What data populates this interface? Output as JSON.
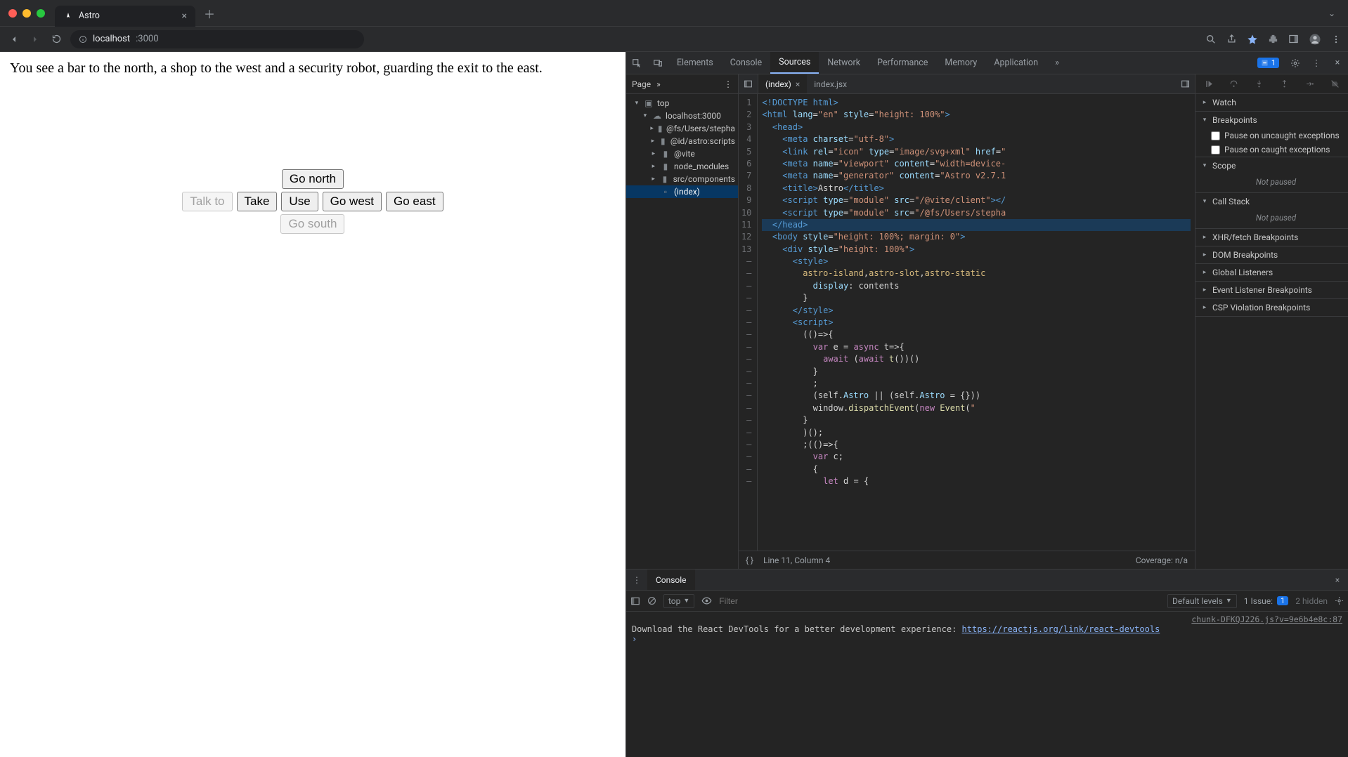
{
  "window": {
    "tab_title": "Astro",
    "url_host": "localhost",
    "url_path": ":3000"
  },
  "game": {
    "description": "You see a bar to the north, a shop to the west and a security robot, guarding the exit to the east.",
    "buttons": {
      "north": "Go north",
      "west": "Go west",
      "east": "Go east",
      "south": "Go south",
      "talk": "Talk to",
      "take": "Take",
      "use": "Use"
    }
  },
  "devtools": {
    "tabs": [
      "Elements",
      "Console",
      "Sources",
      "Network",
      "Performance",
      "Memory",
      "Application"
    ],
    "active_tab": "Sources",
    "issue_count": "1",
    "sources": {
      "left_tab": "Page",
      "tree": {
        "top": "top",
        "host": "localhost:3000",
        "items": [
          "@fs/Users/stepha",
          "@id/astro:scripts",
          "@vite",
          "node_modules",
          "src/components"
        ],
        "file": "(index)"
      },
      "editor_tabs": [
        "(index)",
        "index.jsx"
      ],
      "active_editor_tab": "(index)",
      "gutter": [
        "1",
        "2",
        "3",
        "4",
        "5",
        "6",
        "7",
        "8",
        "9",
        "10",
        "11",
        "12",
        "13",
        "–",
        "–",
        "–",
        "–",
        "–",
        "–",
        "–",
        "–",
        "–",
        "–",
        "–",
        "–",
        "–",
        "–",
        "–",
        "–",
        "–",
        "–",
        "–"
      ],
      "status_line": "Line 11, Column 4",
      "coverage": "Coverage: n/a"
    },
    "debug": {
      "sections": {
        "watch": "Watch",
        "breakpoints": "Breakpoints",
        "bp_uncaught": "Pause on uncaught exceptions",
        "bp_caught": "Pause on caught exceptions",
        "scope": "Scope",
        "scope_state": "Not paused",
        "callstack": "Call Stack",
        "callstack_state": "Not paused",
        "xhr": "XHR/fetch Breakpoints",
        "dom": "DOM Breakpoints",
        "global": "Global Listeners",
        "event": "Event Listener Breakpoints",
        "csp": "CSP Violation Breakpoints"
      }
    },
    "console": {
      "tab": "Console",
      "context": "top",
      "filter_placeholder": "Filter",
      "levels": "Default levels",
      "issues_label": "1 Issue:",
      "issues_count": "1",
      "hidden": "2 hidden",
      "log_source": "chunk-DFKQJ226.js?v=9e6b4e8c:87",
      "log_msg_a": "Download the React DevTools for a better development experience: ",
      "log_msg_link": "https://reactjs.org/link/react-devtools"
    }
  }
}
